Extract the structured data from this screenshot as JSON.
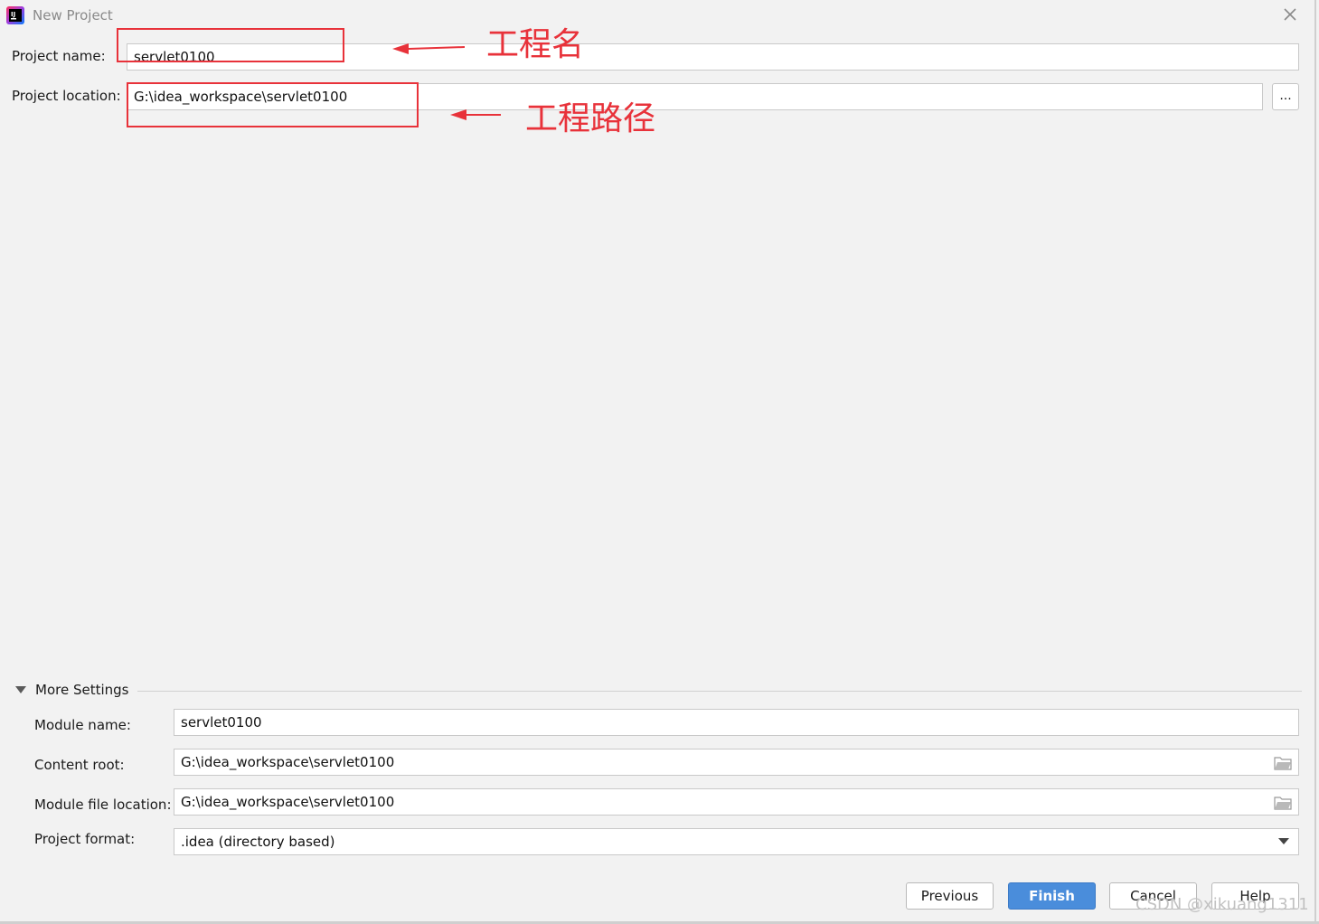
{
  "window": {
    "title": "New Project"
  },
  "fields": {
    "project_name": {
      "label": "Project name:",
      "value": "servlet0100"
    },
    "project_location": {
      "label": "Project location:",
      "value": "G:\\idea_workspace\\servlet0100",
      "browse_label": "..."
    }
  },
  "annotations": {
    "name_note": "工程名",
    "location_note": "工程路径",
    "color": "#e8323a"
  },
  "more_settings": {
    "title": "More Settings",
    "module_name": {
      "label": "Module name:",
      "value": "servlet0100"
    },
    "content_root": {
      "label": "Content root:",
      "value": "G:\\idea_workspace\\servlet0100"
    },
    "module_file_location": {
      "label": "Module file location:",
      "value": "G:\\idea_workspace\\servlet0100"
    },
    "project_format": {
      "label": "Project format:",
      "value": ".idea (directory based)"
    }
  },
  "buttons": {
    "previous": "Previous",
    "finish": "Finish",
    "cancel": "Cancel",
    "help": "Help"
  },
  "watermark": "CSDN @xikuang1311",
  "colors": {
    "accent": "#4a8ddb",
    "background": "#f2f2f2"
  }
}
